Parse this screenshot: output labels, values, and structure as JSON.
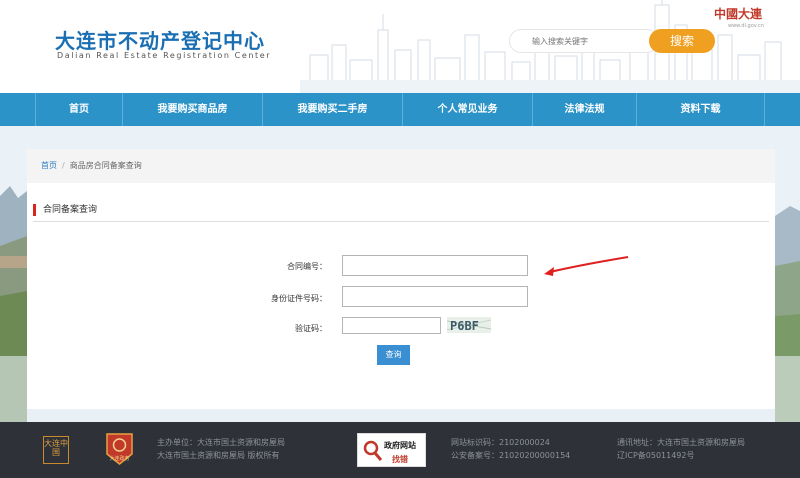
{
  "header": {
    "logo_cn": "大连市不动产登记中心",
    "logo_en": "Dalian Real Estate Registration Center",
    "search_placeholder": "输入搜索关键字",
    "search_button": "搜索",
    "gov_logo": "中國大連",
    "gov_url": "www.dl.gov.cn"
  },
  "nav": {
    "items": [
      {
        "label": "首页"
      },
      {
        "label": "我要购买商品房"
      },
      {
        "label": "我要购买二手房"
      },
      {
        "label": "个人常见业务"
      },
      {
        "label": "法律法规"
      },
      {
        "label": "资料下载"
      }
    ]
  },
  "breadcrumb": {
    "home": "首页",
    "separator": "/",
    "current": "商品房合同备案查询"
  },
  "section": {
    "title": "合同备案查询"
  },
  "form": {
    "contract_no_label": "合同编号：",
    "id_no_label": "身份证件号码：",
    "captcha_label": "验证码：",
    "captcha_text": "P6BF",
    "submit": "查询"
  },
  "footer": {
    "logo1": "大连中国",
    "logo2": "大连政务",
    "sponsor_line1": "主办单位：大连市国土资源和房屋局",
    "sponsor_line2": "大连市国土资源和房屋局 版权所有",
    "site_code": "网站标识码：2102000024",
    "police_record": "公安备案号：21020200000154",
    "address": "通讯地址：大连市国土资源和房屋局",
    "icp": "辽ICP备05011492号",
    "badge_top": "政府网站",
    "badge_bottom": "找错"
  },
  "colors": {
    "brand_blue": "#2b93c8",
    "accent_orange": "#f0a020",
    "title_red": "#d9261c",
    "button_blue": "#3a8ed2",
    "footer_bg": "#2e3138"
  }
}
